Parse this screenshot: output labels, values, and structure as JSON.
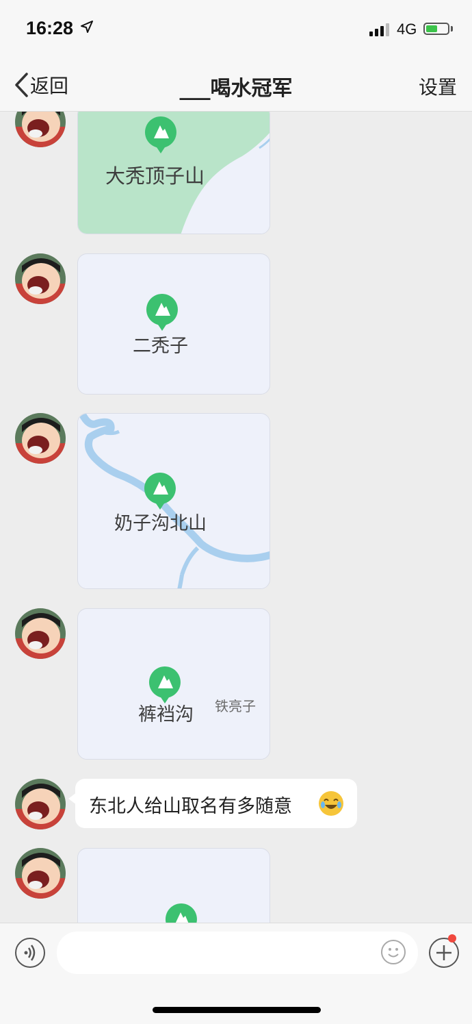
{
  "status_bar": {
    "time": "16:28",
    "network": "4G"
  },
  "nav": {
    "back_label": "返回",
    "title": "___喝水冠军",
    "settings_label": "设置"
  },
  "messages": [
    {
      "type": "location",
      "place": "大秃顶子山"
    },
    {
      "type": "location",
      "place": "二秃子"
    },
    {
      "type": "location",
      "place": "奶子沟北山"
    },
    {
      "type": "location",
      "place": "裤裆沟",
      "nearby": "铁亮子"
    },
    {
      "type": "text",
      "text": "东北人给山取名有多随意",
      "emoji": "rolling-on-floor-laughing"
    },
    {
      "type": "location",
      "place": ""
    }
  ],
  "colors": {
    "pin_green": "#3cc170",
    "map_green": "#b9e4c9",
    "map_blue": "#a9cfee",
    "map_bg": "#eef1fa",
    "chat_bg": "#ededed"
  }
}
